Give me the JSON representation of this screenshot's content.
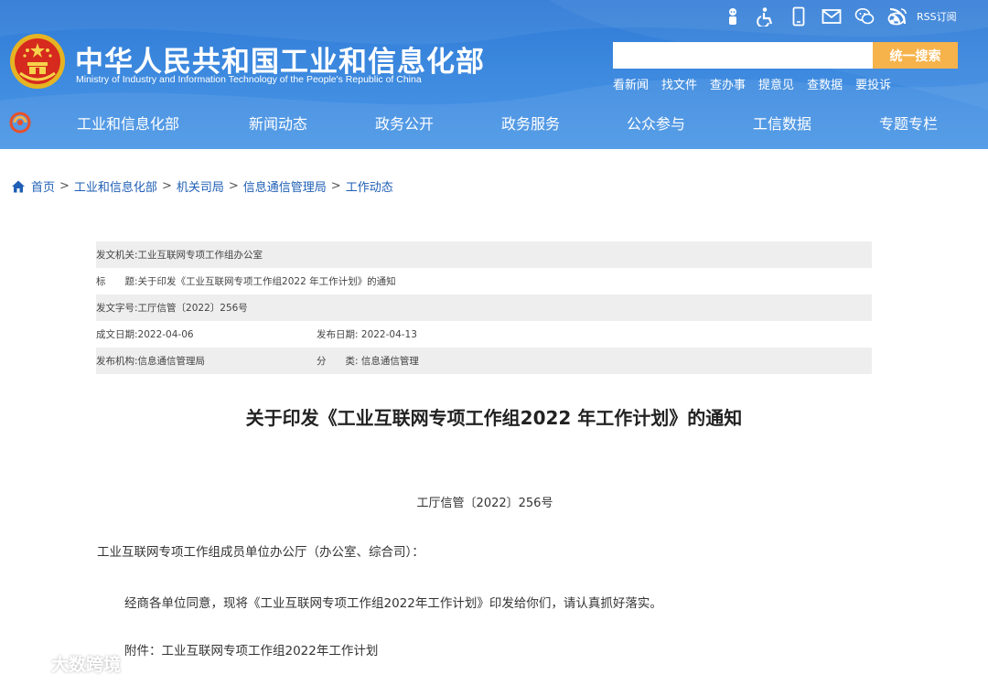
{
  "header": {
    "title": "中华人民共和国工业和信息化部",
    "subtitle": "Ministry of Industry and Information Technology of the People's Republic of China",
    "rss_label": "RSS订阅",
    "search": {
      "placeholder": "",
      "button_label": "统一搜索"
    },
    "quick_links": [
      "看新闻",
      "找文件",
      "查办事",
      "提意见",
      "查数据",
      "要投诉"
    ],
    "icons": [
      "elder-mode-icon",
      "accessibility-icon",
      "mobile-icon",
      "mail-icon",
      "wechat-icon",
      "weibo-icon",
      "rss-icon"
    ],
    "colors": {
      "header_bg": "#3e8be0",
      "search_button": "#f6b34b",
      "link_blue": "#1f5fb5"
    }
  },
  "nav": {
    "items": [
      "工业和信息化部",
      "新闻动态",
      "政务公开",
      "政务服务",
      "公众参与",
      "工信数据",
      "专题专栏"
    ]
  },
  "breadcrumb": {
    "items": [
      "首页",
      "工业和信息化部",
      "机关司局",
      "信息通信管理局",
      "工作动态"
    ],
    "separator": ">"
  },
  "meta": {
    "issuer_label": "发文机关:",
    "issuer": "工业互联网专项工作组办公室",
    "title_label": "标　　题:",
    "title": "关于印发《工业互联网专项工作组2022 年工作计划》的通知",
    "docno_label": "发文字号:",
    "docno": "工厅信管〔2022〕256号",
    "created_label": "成文日期:",
    "created": "2022-04-06",
    "published_label": "发布日期:",
    "published": "2022-04-13",
    "org_label": "发布机构:",
    "org": "信息通信管理局",
    "category_label": "分　　类:",
    "category": "信息通信管理"
  },
  "article": {
    "title": "关于印发《工业互联网专项工作组2022 年工作计划》的通知",
    "doc_no": "工厅信管〔2022〕256号",
    "salutation": "工业互联网专项工作组成员单位办公厅（办公室、综合司）：",
    "body": "经商各单位同意，现将《工业互联网专项工作组2022年工作计划》印发给你们，请认真抓好落实。",
    "attachment": "附件：工业互联网专项工作组2022年工作计划"
  },
  "watermark": {
    "text": "大数跨境"
  }
}
